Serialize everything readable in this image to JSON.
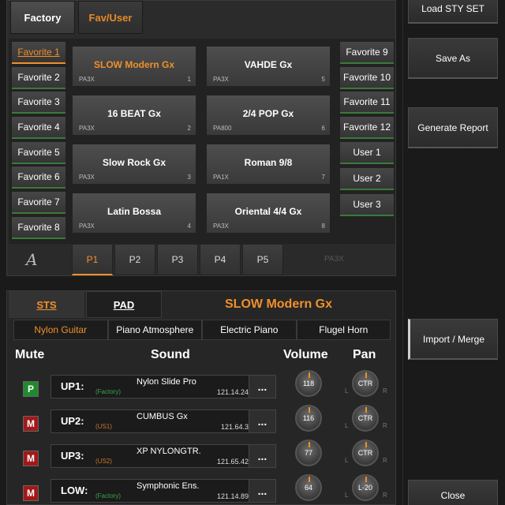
{
  "category_tabs": [
    "Factory",
    "Fav/User"
  ],
  "favorites_left": [
    "Favorite 1",
    "Favorite 2",
    "Favorite 3",
    "Favorite 4",
    "Favorite 5",
    "Favorite 6",
    "Favorite 7",
    "Favorite 8"
  ],
  "favorites_right": [
    "Favorite 9",
    "Favorite 10",
    "Favorite 11",
    "Favorite 12",
    "User 1",
    "User 2",
    "User 3"
  ],
  "styles": [
    {
      "name": "SLOW Modern Gx",
      "bank": "PA3X",
      "num": "1"
    },
    {
      "name": "VAHDE Gx",
      "bank": "PA3X",
      "num": "5"
    },
    {
      "name": "16 BEAT Gx",
      "bank": "PA3X",
      "num": "2"
    },
    {
      "name": "2/4 POP Gx",
      "bank": "PA800",
      "num": "6"
    },
    {
      "name": "Slow Rock Gx",
      "bank": "PA3X",
      "num": "3"
    },
    {
      "name": "Roman 9/8",
      "bank": "PA1X",
      "num": "7"
    },
    {
      "name": "Latin Bossa",
      "bank": "PA3X",
      "num": "4"
    },
    {
      "name": "Oriental 4/4 Gx",
      "bank": "PA3X",
      "num": "8"
    }
  ],
  "pages": [
    "P1",
    "P2",
    "P3",
    "P4",
    "P5"
  ],
  "page_bank_label": "PA3X",
  "side_buttons": {
    "load": "Load STY SET",
    "save_as": "Save As",
    "generate_report": "Generate Report",
    "import_merge": "Import / Merge",
    "close": "Close"
  },
  "sub_tabs": [
    "STS",
    "PAD"
  ],
  "selected_style_title": "SLOW Modern Gx",
  "sts_presets": [
    "Nylon Guitar",
    "Piano Atmosphere",
    "Electric Piano",
    "Flugel Horn"
  ],
  "columns": {
    "mute": "Mute",
    "sound": "Sound",
    "volume": "Volume",
    "pan": "Pan"
  },
  "tracks": [
    {
      "mute": "P",
      "label": "UP1:",
      "sound": "Nylon Slide Pro",
      "bank": "(Factory)",
      "prog": "121.14.24",
      "volume": "118",
      "pan": "CTR"
    },
    {
      "mute": "M",
      "label": "UP2:",
      "sound": "CUMBUS Gx",
      "bank": "(US1)",
      "prog": "121.64.3",
      "volume": "116",
      "pan": "CTR"
    },
    {
      "mute": "M",
      "label": "UP3:",
      "sound": "XP NYLONGTR.",
      "bank": "(US2)",
      "prog": "121.65.42",
      "volume": "77",
      "pan": "CTR"
    },
    {
      "mute": "M",
      "label": "LOW:",
      "sound": "Symphonic Ens.",
      "bank": "(Factory)",
      "prog": "121.14.89",
      "volume": "64",
      "pan": "L-20"
    }
  ],
  "dots_label": "...",
  "pan_left": "L",
  "pan_right": "R",
  "accent_color": "#f0902a",
  "icons": {
    "font_select": "A"
  }
}
